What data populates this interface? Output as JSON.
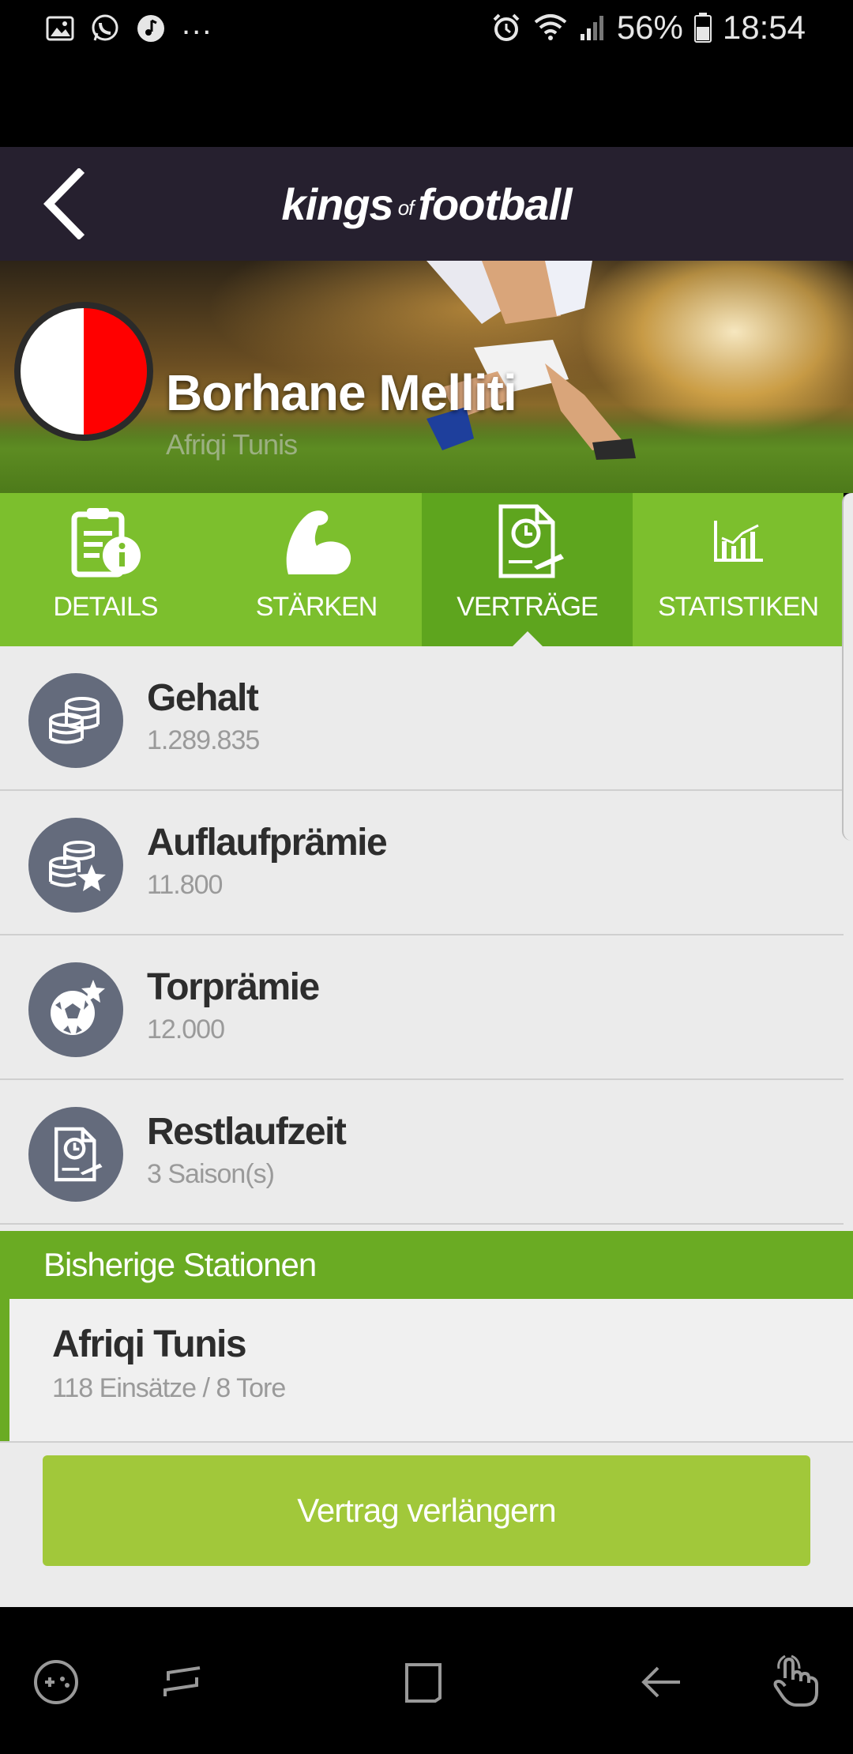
{
  "status_bar": {
    "dots": "...",
    "battery_percent": "56%",
    "time": "18:54"
  },
  "header": {
    "logo_part1": "kings",
    "logo_part2": "of",
    "logo_part3": "football"
  },
  "player": {
    "name": "Borhane Melliti",
    "club": "Afriqi Tunis",
    "crest_colors": [
      "#ffffff",
      "#ff0000"
    ]
  },
  "tabs": [
    {
      "label": "DETAILS",
      "icon": "clipboard-info-icon",
      "active": false
    },
    {
      "label": "STÄRKEN",
      "icon": "flexed-arm-icon",
      "active": false
    },
    {
      "label": "VERTRÄGE",
      "icon": "contract-clock-icon",
      "active": true
    },
    {
      "label": "STATISTIKEN",
      "icon": "bar-chart-icon",
      "active": false
    }
  ],
  "contract_rows": [
    {
      "title": "Gehalt",
      "value": "1.289.835",
      "icon": "coins-stack-icon"
    },
    {
      "title": "Auflaufprämie",
      "value": "11.800",
      "icon": "coins-star-icon"
    },
    {
      "title": "Torprämie",
      "value": "12.000",
      "icon": "ball-star-icon"
    },
    {
      "title": "Restlaufzeit",
      "value": "3 Saison(s)",
      "icon": "contract-clock-icon"
    }
  ],
  "previous_stations": {
    "heading": "Bisherige Stationen",
    "items": [
      {
        "club": "Afriqi Tunis",
        "stats": "118 Einsätze / 8 Tore"
      }
    ]
  },
  "actions": {
    "extend_contract": "Vertrag verlängern"
  },
  "colors": {
    "tab_green": "#7cbf2d",
    "tab_active": "#5ea51e",
    "section_green": "#6aab23",
    "button_green": "#a1c83a",
    "header_bg": "#26202f",
    "icon_circle": "#646b7c"
  }
}
